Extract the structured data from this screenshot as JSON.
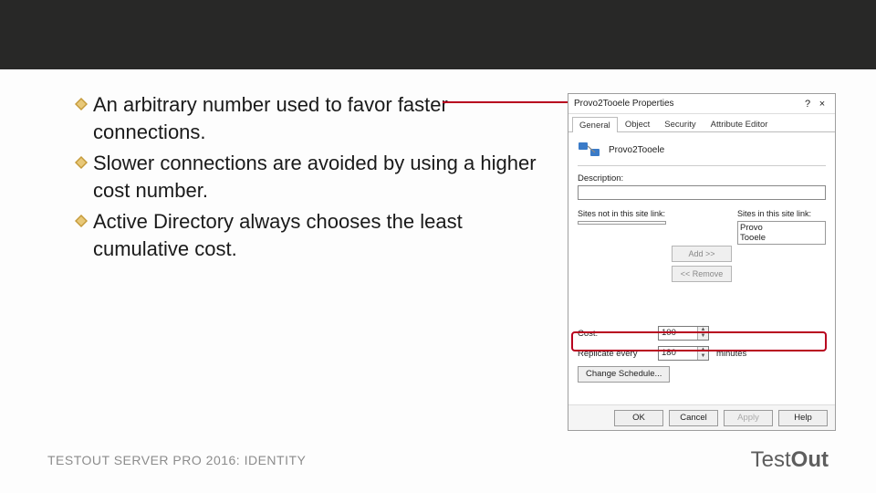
{
  "bullets": [
    "An arbitrary number used to favor faster connections.",
    "Slower connections are avoided by using a higher cost number.",
    "Active Directory always chooses the least cumulative cost."
  ],
  "footer": {
    "course_line": "TESTOUT SERVER PRO 2016: IDENTITY",
    "logo_thin": "Test",
    "logo_bold": "Out"
  },
  "dialog": {
    "title": "Provo2Tooele Properties",
    "help": "?",
    "close": "×",
    "tabs": {
      "general": "General",
      "object": "Object",
      "security": "Security",
      "attr": "Attribute Editor"
    },
    "object_name": "Provo2Tooele",
    "description_label": "Description:",
    "description_value": "",
    "left_list_label": "Sites not in this site link:",
    "right_list_label": "Sites in this site link:",
    "right_items": [
      "Provo",
      "Tooele"
    ],
    "add_btn": "Add >>",
    "remove_btn": "<< Remove",
    "cost_label": "Cost:",
    "cost_value": "100",
    "replicate_label": "Replicate every",
    "replicate_value": "180",
    "replicate_unit": "minutes",
    "schedule_btn": "Change Schedule...",
    "ok": "OK",
    "cancel": "Cancel",
    "apply": "Apply",
    "helpbtn": "Help"
  }
}
